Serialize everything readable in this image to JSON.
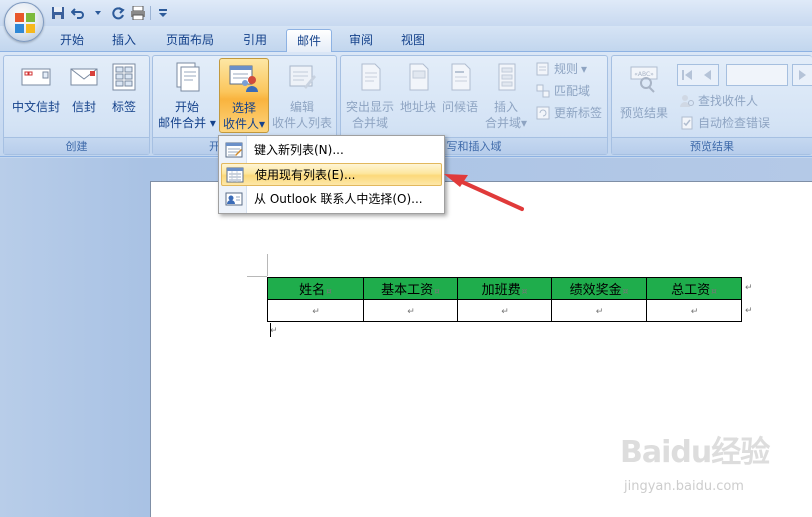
{
  "quick_access": {
    "icons": [
      "save-icon",
      "undo-icon",
      "redo-icon",
      "print-preview-icon",
      "customize-icon"
    ]
  },
  "tabs": [
    {
      "label": "开始",
      "active": false
    },
    {
      "label": "插入",
      "active": false
    },
    {
      "label": "页面布局",
      "active": false
    },
    {
      "label": "引用",
      "active": false
    },
    {
      "label": "邮件",
      "active": true
    },
    {
      "label": "审阅",
      "active": false
    },
    {
      "label": "视图",
      "active": false
    }
  ],
  "groups": {
    "create": {
      "label": "创建",
      "buttons": [
        "中文信封",
        "信封",
        "标签"
      ]
    },
    "start_merge": {
      "label": "开",
      "start_merge_line1": "开始",
      "start_merge_line2": "邮件合并",
      "select_recipients_line1": "选择",
      "select_recipients_line2": "收件人",
      "edit_recipients_line1": "编辑",
      "edit_recipients_line2": "收件人列表"
    },
    "write_insert": {
      "label": "编写和插入域",
      "label_visible": "写和插入域",
      "highlight_line1": "突出显示",
      "highlight_line2": "合并域",
      "address_block": "地址块",
      "greeting": "问候语",
      "insert_line1": "插入",
      "insert_line2": "合并域",
      "rules": "规则",
      "match_fields": "匹配域",
      "update_labels": "更新标签"
    },
    "preview": {
      "label": "预览结果",
      "preview_results": "预览结果",
      "find_recipient": "查找收件人",
      "auto_check": "自动检查错误"
    }
  },
  "menu": {
    "items": [
      {
        "label": "键入新列表(N)...",
        "icon": "new-list-icon",
        "hover": false
      },
      {
        "label": "使用现有列表(E)...",
        "icon": "existing-list-icon",
        "hover": true
      },
      {
        "label": "从 Outlook 联系人中选择(O)...",
        "icon": "outlook-contacts-icon",
        "hover": false
      }
    ]
  },
  "document": {
    "table": {
      "headers": [
        "姓名",
        "基本工资",
        "加班费",
        "绩效奖金",
        "总工资"
      ],
      "header_color": "#1fad4c"
    }
  },
  "watermark": {
    "main": "Baidu经验",
    "sub": "jingyan.baidu.com"
  },
  "colors": {
    "ribbon_text": "#15428b",
    "highlight": "#fcd97a",
    "arrow": "#e03a3a"
  }
}
